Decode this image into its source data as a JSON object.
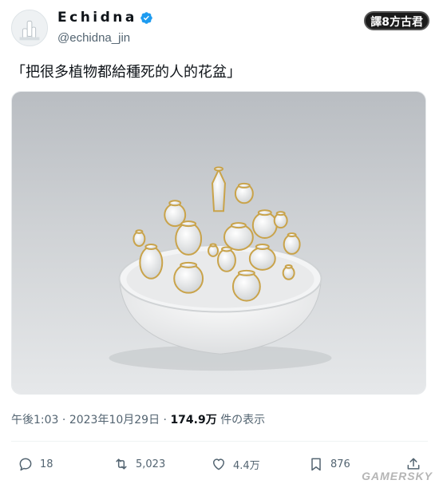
{
  "user": {
    "display_name": "Echidna",
    "handle": "@echidna_jin",
    "verified": true
  },
  "stamp_label": "譯8方古君",
  "tweet": {
    "text": "「把很多植物都給種死的人的花盆」"
  },
  "meta": {
    "time": "午後1:03",
    "separator1": "·",
    "date": "2023年10月29日",
    "separator2": "·",
    "views_count": "174.9万",
    "views_label": "件の表示"
  },
  "actions": {
    "reply_count": "18",
    "retweet_count": "5,023",
    "like_count": "4.4万",
    "bookmark_count": "876"
  },
  "watermark": "GAMERSKY",
  "colors": {
    "text": "#0f1419",
    "secondary": "#536471",
    "verified": "#1d9bf0"
  }
}
